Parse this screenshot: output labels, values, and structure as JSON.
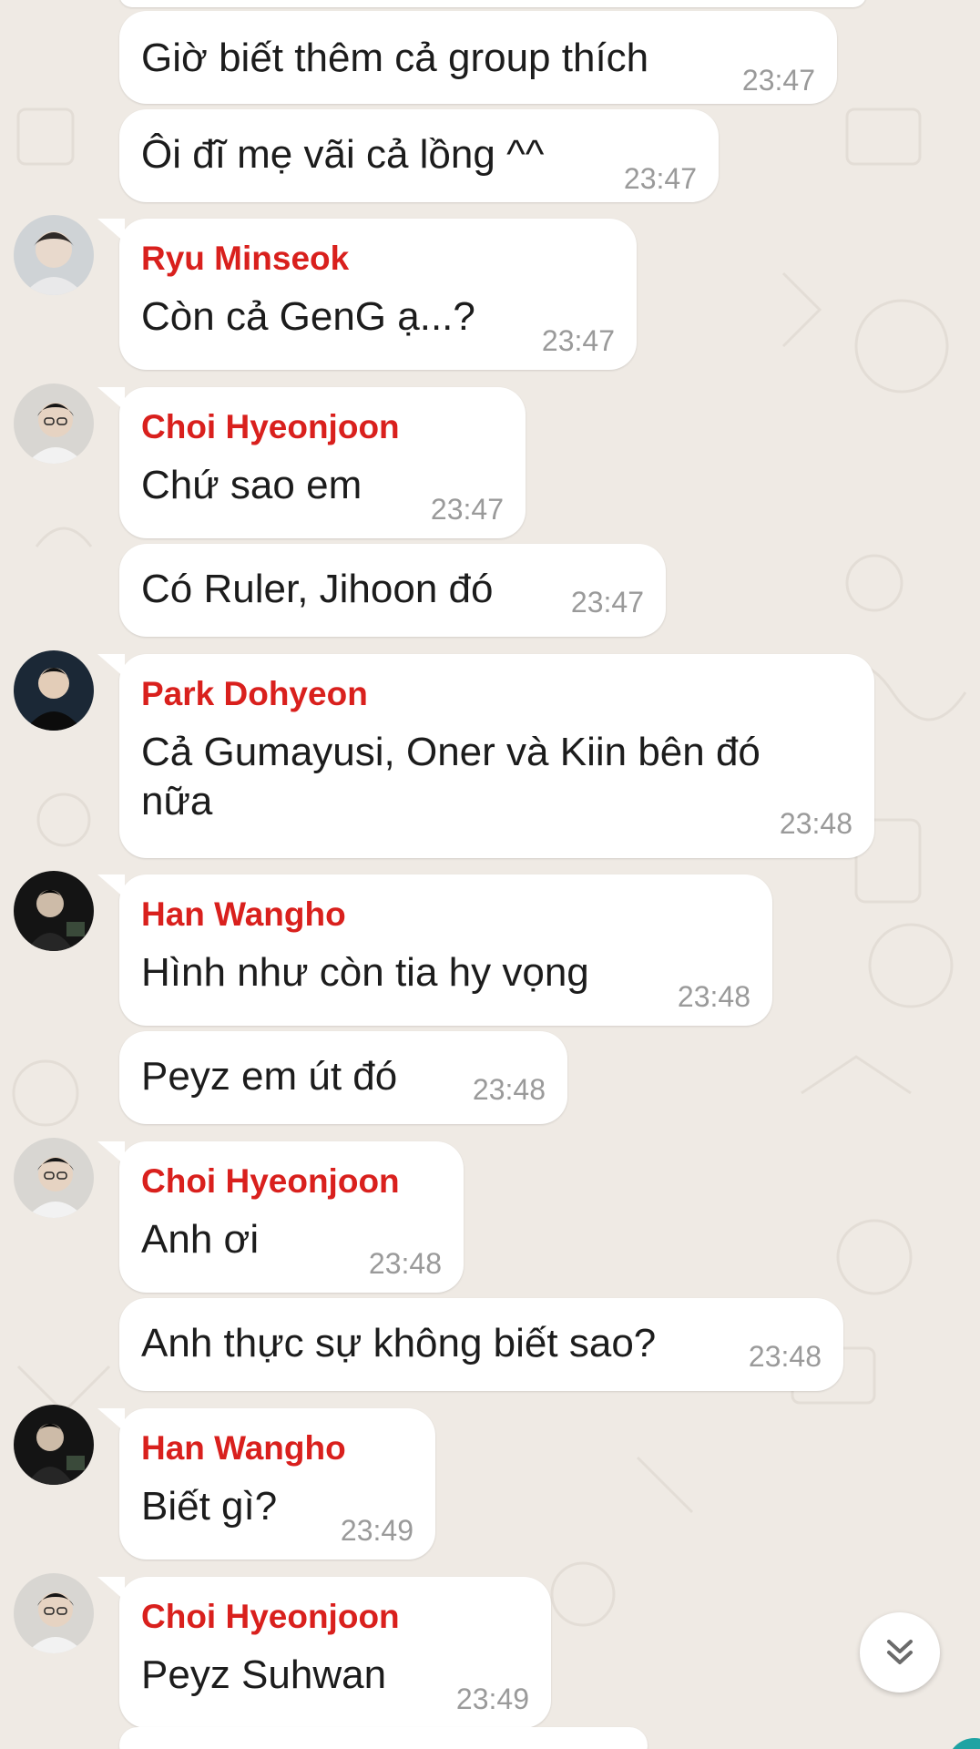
{
  "messages": [
    {
      "sender": "",
      "text": "Giờ biết thêm cả group thích",
      "time": "23:47"
    },
    {
      "sender": "",
      "text": "Ôi đĩ mẹ vãi cả lồng ^^",
      "time": "23:47"
    },
    {
      "sender": "Ryu Minseok",
      "text": "Còn cả GenG ạ...?",
      "time": "23:47"
    },
    {
      "sender": "Choi Hyeonjoon",
      "text": "Chứ sao em",
      "time": "23:47"
    },
    {
      "sender": "",
      "text": "Có Ruler, Jihoon đó",
      "time": "23:47"
    },
    {
      "sender": "Park Dohyeon",
      "text_line1": "Cả Gumayusi, Oner và Kiin bên đó",
      "text_line2": "nữa",
      "time": "23:48"
    },
    {
      "sender": "Han Wangho",
      "text": "Hình như còn tia hy vọng",
      "time": "23:48"
    },
    {
      "sender": "",
      "text": "Peyz em út đó",
      "time": "23:48"
    },
    {
      "sender": "Choi Hyeonjoon",
      "text": "Anh ơi",
      "time": "23:48"
    },
    {
      "sender": "",
      "text": "Anh thực sự không biết sao?",
      "time": "23:48"
    },
    {
      "sender": "Han Wangho",
      "text": "Biết gì?",
      "time": "23:49"
    },
    {
      "sender": "Choi Hyeonjoon",
      "text": "Peyz Suhwan",
      "time": "23:49"
    }
  ],
  "colors": {
    "background": "#efeae4",
    "bubble": "#ffffff",
    "sender_name": "#d9201d",
    "timestamp": "#9a9a9a"
  },
  "icons": {
    "scroll_down": "double-chevron-down-icon"
  }
}
